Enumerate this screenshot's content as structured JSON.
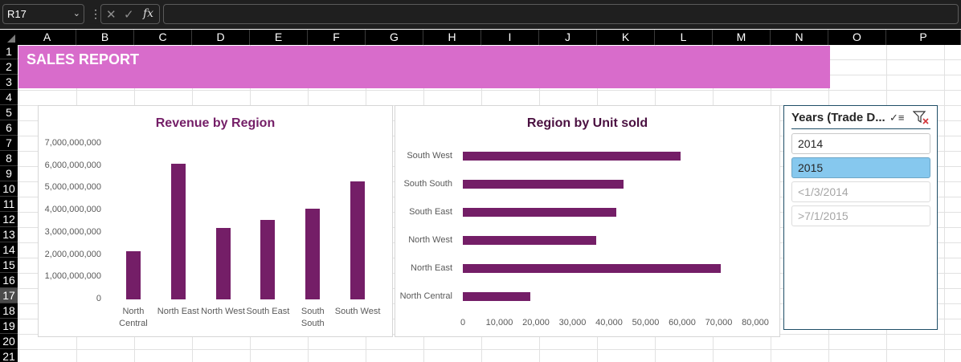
{
  "formula_bar": {
    "name_box": "R17",
    "fx_label": "fx",
    "formula_value": ""
  },
  "sheet": {
    "columns": [
      "A",
      "B",
      "C",
      "D",
      "E",
      "F",
      "G",
      "H",
      "I",
      "J",
      "K",
      "L",
      "M",
      "N",
      "O",
      "P"
    ],
    "rows": [
      "1",
      "2",
      "3",
      "4",
      "5",
      "6",
      "7",
      "8",
      "9",
      "10",
      "11",
      "12",
      "13",
      "14",
      "15",
      "16",
      "17",
      "18",
      "19",
      "20",
      "21"
    ],
    "active_row": "17"
  },
  "banner": {
    "title": "SALES REPORT",
    "color": "#d86ccb"
  },
  "bar_color": "#741e67",
  "chart_data": [
    {
      "type": "bar",
      "orientation": "vertical",
      "title": "Revenue by Region",
      "categories": [
        "North Central",
        "North East",
        "North West",
        "South East",
        "South South",
        "South West"
      ],
      "category_lines": [
        [
          "North",
          "Central"
        ],
        [
          "North East"
        ],
        [
          "North West"
        ],
        [
          "South East"
        ],
        [
          "South",
          "South"
        ],
        [
          "South West"
        ]
      ],
      "values": [
        2150000000,
        6100000000,
        3220000000,
        3560000000,
        4080000000,
        5320000000
      ],
      "ylim": [
        0,
        7000000000
      ],
      "yticks": [
        "0",
        "1,000,000,000",
        "2,000,000,000",
        "3,000,000,000",
        "4,000,000,000",
        "5,000,000,000",
        "6,000,000,000",
        "7,000,000,000"
      ],
      "xlabel": "",
      "ylabel": "",
      "grid": false,
      "legend": "none"
    },
    {
      "type": "bar",
      "orientation": "horizontal",
      "title": "Region by Unit sold",
      "categories": [
        "North Central",
        "North East",
        "North West",
        "South East",
        "South South",
        "South West"
      ],
      "values": [
        18500,
        70500,
        36500,
        42000,
        44000,
        59500
      ],
      "xlim": [
        0,
        80000
      ],
      "xticks": [
        "0",
        "10,000",
        "20,000",
        "30,000",
        "40,000",
        "50,000",
        "60,000",
        "70,000",
        "80,000"
      ],
      "xlabel": "",
      "ylabel": "",
      "grid": false,
      "legend": "none"
    }
  ],
  "slicer": {
    "title": "Years (Trade D...",
    "multiselect_icon": "multi-select-icon",
    "clear_icon": "clear-filter-icon",
    "items": [
      {
        "label": "2014",
        "state": "available"
      },
      {
        "label": "2015",
        "state": "selected"
      },
      {
        "label": "<1/3/2014",
        "state": "disabled"
      },
      {
        "label": ">7/1/2015",
        "state": "disabled"
      }
    ]
  }
}
